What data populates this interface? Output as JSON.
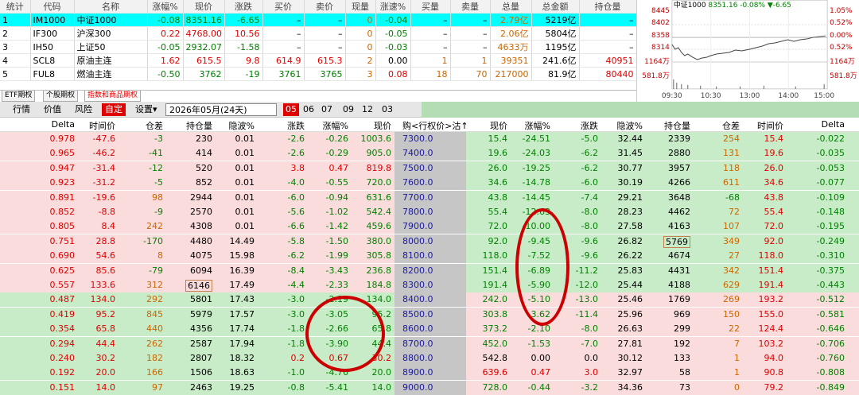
{
  "quote_table": {
    "headers": [
      "统计",
      "代码",
      "名称",
      "涨幅%",
      "现价",
      "涨跌",
      "买价",
      "卖价",
      "现量",
      "涨速%",
      "买量",
      "卖量",
      "总量",
      "总金额",
      "持仓量"
    ],
    "rows": [
      {
        "no": "1",
        "code": "IM1000",
        "name": "中证1000",
        "chg_pct": "-0.08",
        "price": "8351.16",
        "chg": "-6.65",
        "bid": "–",
        "ask": "–",
        "vol": "0",
        "speed": "-0.04",
        "bid_vol": "–",
        "ask_vol": "–",
        "total": "2.79亿",
        "amount": "5219亿",
        "oi": "–"
      },
      {
        "no": "2",
        "code": "IF300",
        "name": "沪深300",
        "chg_pct": "0.22",
        "price": "4768.00",
        "chg": "10.56",
        "bid": "–",
        "ask": "–",
        "vol": "0",
        "speed": "-0.05",
        "bid_vol": "–",
        "ask_vol": "–",
        "total": "2.06亿",
        "amount": "5804亿",
        "oi": "–"
      },
      {
        "no": "3",
        "code": "IH50",
        "name": "上证50",
        "chg_pct": "-0.05",
        "price": "2932.07",
        "chg": "-1.58",
        "bid": "–",
        "ask": "–",
        "vol": "0",
        "speed": "-0.03",
        "bid_vol": "–",
        "ask_vol": "–",
        "total": "4633万",
        "amount": "1195亿",
        "oi": "–"
      },
      {
        "no": "4",
        "code": "SCL8",
        "name": "原油主连",
        "chg_pct": "1.62",
        "price": "615.5",
        "chg": "9.8",
        "bid": "614.9",
        "ask": "615.3",
        "vol": "2",
        "speed": "0.00",
        "bid_vol": "1",
        "ask_vol": "1",
        "total": "39351",
        "amount": "241.6亿",
        "oi": "40951"
      },
      {
        "no": "5",
        "code": "FUL8",
        "name": "燃油主连",
        "chg_pct": "-0.50",
        "price": "3762",
        "chg": "-19",
        "bid": "3761",
        "ask": "3765",
        "vol": "3",
        "speed": "0.08",
        "bid_vol": "18",
        "ask_vol": "70",
        "total": "217000",
        "amount": "81.9亿",
        "oi": "80440"
      }
    ]
  },
  "chart": {
    "title": "中证1000",
    "price": "8351.16",
    "chg_pct": "-0.08%",
    "chg": "▼-6.65",
    "left_ticks": [
      "8445",
      "8402",
      "8358",
      "8314",
      "1164万",
      "581.8万"
    ],
    "right_ticks": [
      "1.05%",
      "0.52%",
      "0.00%",
      "0.52%",
      "1164万",
      "581.8万"
    ],
    "time_ticks": [
      "09:30",
      "10:30",
      "13:00",
      "14:00",
      "15:00"
    ]
  },
  "tabs": [
    "ETF期权",
    "个股期权",
    "指数和商品期权"
  ],
  "toolbar": {
    "items": [
      "行情",
      "价值",
      "风险",
      "自定",
      "设置▾"
    ],
    "expiry": "2026年05月(24天)",
    "months": [
      "05",
      "06",
      "07",
      "09",
      "12",
      "03"
    ]
  },
  "option_headers": {
    "call": [
      "Delta",
      "时间价",
      "仓差",
      "持仓量",
      "隐波%",
      "涨跌",
      "涨幅%",
      "现价"
    ],
    "strike": "购<行权价>沽↑",
    "put": [
      "现价",
      "涨幅%",
      "涨跌",
      "隐波%",
      "持仓量",
      "仓差",
      "时间价",
      "Delta"
    ]
  },
  "option_rows": [
    {
      "c_delta": "0.978",
      "c_tv": "-47.6",
      "c_oich": "-3",
      "c_oi": "230",
      "c_iv": "0.01",
      "c_chg": "-2.6",
      "c_pct": "-0.26",
      "c_px": "1003.6",
      "strike": "7300.0",
      "p_px": "15.4",
      "p_pct": "-24.51",
      "p_chg": "-5.0",
      "p_iv": "32.44",
      "p_oi": "2339",
      "p_oich": "254",
      "p_tv": "15.4",
      "p_delta": "-0.022"
    },
    {
      "c_delta": "0.965",
      "c_tv": "-46.2",
      "c_oich": "-41",
      "c_oi": "414",
      "c_iv": "0.01",
      "c_chg": "-2.6",
      "c_pct": "-0.29",
      "c_px": "905.0",
      "strike": "7400.0",
      "p_px": "19.6",
      "p_pct": "-24.03",
      "p_chg": "-6.2",
      "p_iv": "31.45",
      "p_oi": "2880",
      "p_oich": "131",
      "p_tv": "19.6",
      "p_delta": "-0.035"
    },
    {
      "c_delta": "0.947",
      "c_tv": "-31.4",
      "c_oich": "-12",
      "c_oi": "520",
      "c_iv": "0.01",
      "c_chg": "3.8",
      "c_pct": "0.47",
      "c_px": "819.8",
      "strike": "7500.0",
      "p_px": "26.0",
      "p_pct": "-19.25",
      "p_chg": "-6.2",
      "p_iv": "30.77",
      "p_oi": "3957",
      "p_oich": "118",
      "p_tv": "26.0",
      "p_delta": "-0.053"
    },
    {
      "c_delta": "0.923",
      "c_tv": "-31.2",
      "c_oich": "-5",
      "c_oi": "852",
      "c_iv": "0.01",
      "c_chg": "-4.0",
      "c_pct": "-0.55",
      "c_px": "720.0",
      "strike": "7600.0",
      "p_px": "34.6",
      "p_pct": "-14.78",
      "p_chg": "-6.0",
      "p_iv": "30.19",
      "p_oi": "4266",
      "p_oich": "611",
      "p_tv": "34.6",
      "p_delta": "-0.077"
    },
    {
      "c_delta": "0.891",
      "c_tv": "-19.6",
      "c_oich": "98",
      "c_oi": "2944",
      "c_iv": "0.01",
      "c_chg": "-6.0",
      "c_pct": "-0.94",
      "c_px": "631.6",
      "strike": "7700.0",
      "p_px": "43.8",
      "p_pct": "-14.45",
      "p_chg": "-7.4",
      "p_iv": "29.21",
      "p_oi": "3648",
      "p_oich": "-68",
      "p_tv": "43.8",
      "p_delta": "-0.109"
    },
    {
      "c_delta": "0.852",
      "c_tv": "-8.8",
      "c_oich": "-9",
      "c_oi": "2570",
      "c_iv": "0.01",
      "c_chg": "-5.6",
      "c_pct": "-1.02",
      "c_px": "542.4",
      "strike": "7800.0",
      "p_px": "55.4",
      "p_pct": "-12.63",
      "p_chg": "-8.0",
      "p_iv": "28.23",
      "p_oi": "4462",
      "p_oich": "72",
      "p_tv": "55.4",
      "p_delta": "-0.148"
    },
    {
      "c_delta": "0.805",
      "c_tv": "8.4",
      "c_oich": "242",
      "c_oi": "4308",
      "c_iv": "0.01",
      "c_chg": "-6.6",
      "c_pct": "-1.42",
      "c_px": "459.6",
      "strike": "7900.0",
      "p_px": "72.0",
      "p_pct": "-10.00",
      "p_chg": "-8.0",
      "p_iv": "27.58",
      "p_oi": "4163",
      "p_oich": "107",
      "p_tv": "72.0",
      "p_delta": "-0.195"
    },
    {
      "c_delta": "0.751",
      "c_tv": "28.8",
      "c_oich": "-170",
      "c_oi": "4480",
      "c_iv": "14.49",
      "c_chg": "-5.8",
      "c_pct": "-1.50",
      "c_px": "380.0",
      "strike": "8000.0",
      "p_px": "92.0",
      "p_pct": "-9.45",
      "p_chg": "-9.6",
      "p_iv": "26.82",
      "p_oi": "5769",
      "p_oich": "349",
      "p_tv": "92.0",
      "p_delta": "-0.249"
    },
    {
      "c_delta": "0.690",
      "c_tv": "54.6",
      "c_oich": "8",
      "c_oi": "4075",
      "c_iv": "15.98",
      "c_chg": "-6.2",
      "c_pct": "-1.99",
      "c_px": "305.8",
      "strike": "8100.0",
      "p_px": "118.0",
      "p_pct": "-7.52",
      "p_chg": "-9.6",
      "p_iv": "26.22",
      "p_oi": "4674",
      "p_oich": "27",
      "p_tv": "118.0",
      "p_delta": "-0.310"
    },
    {
      "c_delta": "0.625",
      "c_tv": "85.6",
      "c_oich": "-79",
      "c_oi": "6094",
      "c_iv": "16.39",
      "c_chg": "-8.4",
      "c_pct": "-3.43",
      "c_px": "236.8",
      "strike": "8200.0",
      "p_px": "151.4",
      "p_pct": "-6.89",
      "p_chg": "-11.2",
      "p_iv": "25.83",
      "p_oi": "4431",
      "p_oich": "342",
      "p_tv": "151.4",
      "p_delta": "-0.375"
    },
    {
      "c_delta": "0.557",
      "c_tv": "133.6",
      "c_oich": "312",
      "c_oi": "6146",
      "c_iv": "17.49",
      "c_chg": "-4.4",
      "c_pct": "-2.33",
      "c_px": "184.8",
      "strike": "8300.0",
      "p_px": "191.4",
      "p_pct": "-5.90",
      "p_chg": "-12.0",
      "p_iv": "25.44",
      "p_oi": "4188",
      "p_oich": "629",
      "p_tv": "191.4",
      "p_delta": "-0.443"
    },
    {
      "c_delta": "0.487",
      "c_tv": "134.0",
      "c_oich": "292",
      "c_oi": "5801",
      "c_iv": "17.43",
      "c_chg": "-3.0",
      "c_pct": "-2.19",
      "c_px": "134.0",
      "strike": "8400.0",
      "p_px": "242.0",
      "p_pct": "-5.10",
      "p_chg": "-13.0",
      "p_iv": "25.46",
      "p_oi": "1769",
      "p_oich": "269",
      "p_tv": "193.2",
      "p_delta": "-0.512"
    },
    {
      "c_delta": "0.419",
      "c_tv": "95.2",
      "c_oich": "845",
      "c_oi": "5979",
      "c_iv": "17.57",
      "c_chg": "-3.0",
      "c_pct": "-3.05",
      "c_px": "95.2",
      "strike": "8500.0",
      "p_px": "303.8",
      "p_pct": "-3.62",
      "p_chg": "-11.4",
      "p_iv": "25.96",
      "p_oi": "969",
      "p_oich": "150",
      "p_tv": "155.0",
      "p_delta": "-0.581"
    },
    {
      "c_delta": "0.354",
      "c_tv": "65.8",
      "c_oich": "440",
      "c_oi": "4356",
      "c_iv": "17.74",
      "c_chg": "-1.8",
      "c_pct": "-2.66",
      "c_px": "65.8",
      "strike": "8600.0",
      "p_px": "373.2",
      "p_pct": "-2.10",
      "p_chg": "-8.0",
      "p_iv": "26.63",
      "p_oi": "299",
      "p_oich": "22",
      "p_tv": "124.4",
      "p_delta": "-0.646"
    },
    {
      "c_delta": "0.294",
      "c_tv": "44.4",
      "c_oich": "262",
      "c_oi": "2587",
      "c_iv": "17.94",
      "c_chg": "-1.8",
      "c_pct": "-3.90",
      "c_px": "44.4",
      "strike": "8700.0",
      "p_px": "452.0",
      "p_pct": "-1.53",
      "p_chg": "-7.0",
      "p_iv": "27.81",
      "p_oi": "192",
      "p_oich": "7",
      "p_tv": "103.2",
      "p_delta": "-0.706"
    },
    {
      "c_delta": "0.240",
      "c_tv": "30.2",
      "c_oich": "182",
      "c_oi": "2807",
      "c_iv": "18.32",
      "c_chg": "0.2",
      "c_pct": "0.67",
      "c_px": "30.2",
      "strike": "8800.0",
      "p_px": "542.8",
      "p_pct": "0.00",
      "p_chg": "0.0",
      "p_iv": "30.12",
      "p_oi": "133",
      "p_oich": "1",
      "p_tv": "94.0",
      "p_delta": "-0.760"
    },
    {
      "c_delta": "0.192",
      "c_tv": "20.0",
      "c_oich": "166",
      "c_oi": "1506",
      "c_iv": "18.63",
      "c_chg": "-1.0",
      "c_pct": "-4.76",
      "c_px": "20.0",
      "strike": "8900.0",
      "p_px": "639.6",
      "p_pct": "0.47",
      "p_chg": "3.0",
      "p_iv": "32.97",
      "p_oi": "58",
      "p_oich": "1",
      "p_tv": "90.8",
      "p_delta": "-0.808"
    },
    {
      "c_delta": "0.151",
      "c_tv": "14.0",
      "c_oich": "97",
      "c_oi": "2463",
      "c_iv": "19.25",
      "c_chg": "-0.8",
      "c_pct": "-5.41",
      "c_px": "14.0",
      "strike": "9000.0",
      "p_px": "728.0",
      "p_pct": "-0.44",
      "p_chg": "-3.2",
      "p_iv": "34.36",
      "p_oi": "73",
      "p_oich": "0",
      "p_tv": "79.2",
      "p_delta": "-0.849"
    }
  ]
}
